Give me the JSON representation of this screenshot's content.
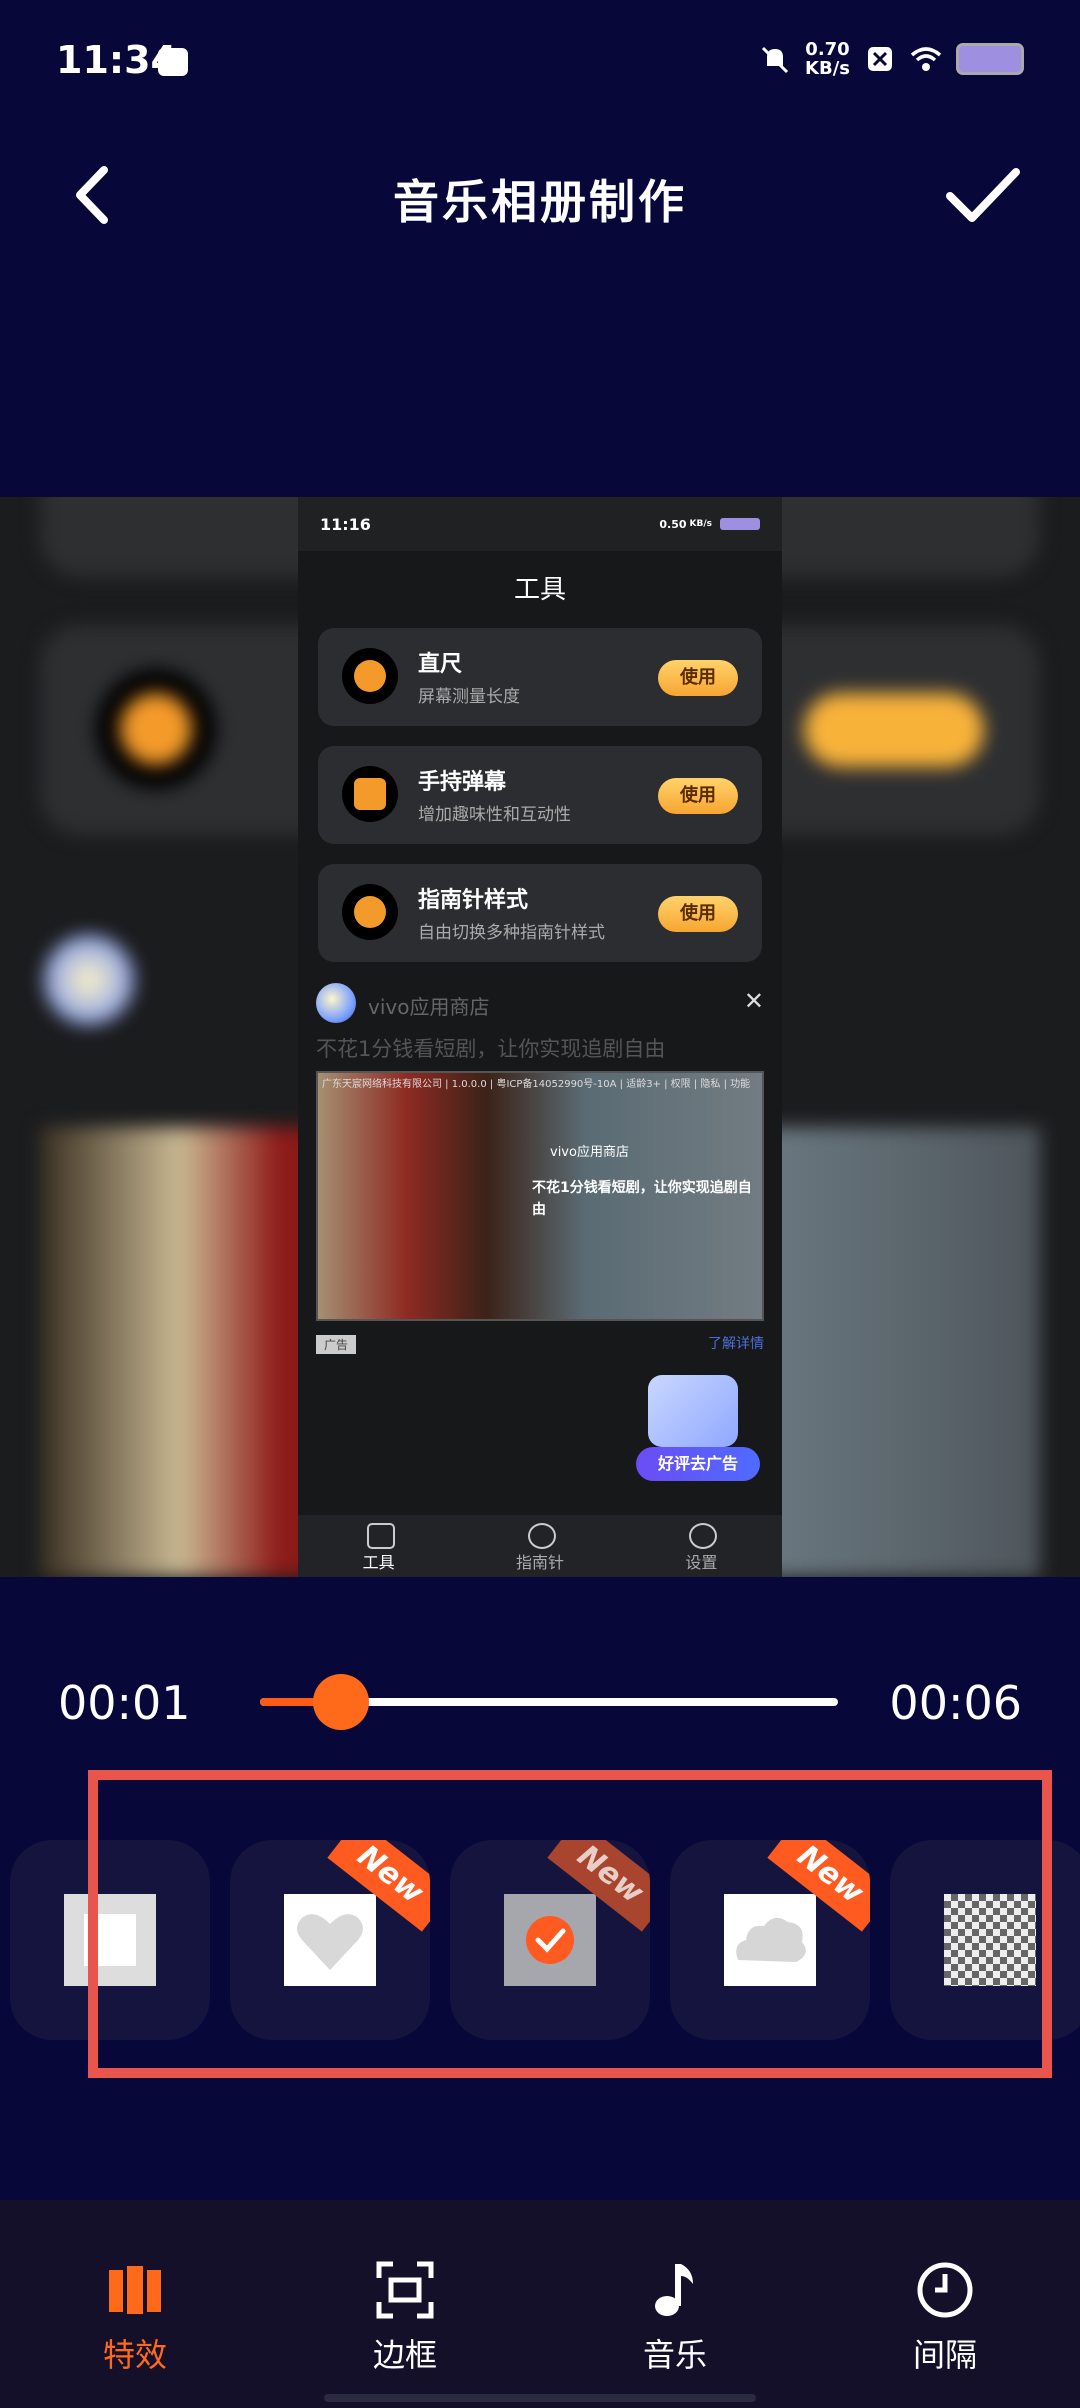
{
  "status_bar": {
    "time": "11:34",
    "speed_value": "0.70",
    "speed_unit": "KB/s"
  },
  "header": {
    "title": "音乐相册制作"
  },
  "preview": {
    "status_time": "11:16",
    "status_speed": "0.50",
    "status_speed_unit": "KB/s",
    "page_title": "工具",
    "tools": [
      {
        "name": "直尺",
        "desc": "屏幕测量长度",
        "action": "使用",
        "icon": "ruler-icon"
      },
      {
        "name": "手持弹幕",
        "desc": "增加趣味性和互动性",
        "action": "使用",
        "icon": "danmaku-icon"
      },
      {
        "name": "指南针样式",
        "desc": "自由切换多种指南针样式",
        "action": "使用",
        "icon": "compass-icon"
      }
    ],
    "ad": {
      "app_name": "vivo应用商店",
      "tagline": "不花1分钱看短剧，让你实现追剧自由",
      "small_print": "广东天宸网络科技有限公司 | 1.0.0.0 | 粤ICP备14052990号-10A | 适龄3+ | 权限 | 隐私 | 功能",
      "inner_name": "vivo应用商店",
      "inner_text": "不花1分钱看短剧，让你实现追剧自由",
      "label": "广告",
      "learn_more": "了解详情",
      "rate_button": "好评去广告"
    },
    "tabs": [
      {
        "label": "工具",
        "active": true
      },
      {
        "label": "指南针",
        "active": false
      },
      {
        "label": "设置",
        "active": false
      }
    ]
  },
  "timeline": {
    "current": "00:01",
    "total": "00:06",
    "progress": 0.14
  },
  "effects": [
    {
      "name": "square-transition",
      "is_new": false,
      "selected": false
    },
    {
      "name": "heart-transition",
      "is_new": true,
      "selected": false
    },
    {
      "name": "selected-transition",
      "is_new": true,
      "selected": true
    },
    {
      "name": "cloud-transition",
      "is_new": true,
      "selected": false
    },
    {
      "name": "mosaic-transition",
      "is_new": false,
      "selected": false
    }
  ],
  "new_badge_text": "New",
  "bottom_nav": [
    {
      "label": "特效",
      "icon": "effects-icon",
      "active": true
    },
    {
      "label": "边框",
      "icon": "frame-icon",
      "active": false
    },
    {
      "label": "音乐",
      "icon": "music-icon",
      "active": false
    },
    {
      "label": "间隔",
      "icon": "clock-icon",
      "active": false
    }
  ],
  "colors": {
    "background": "#07073a",
    "accent": "#ff6a1a",
    "highlight": "#e9544c"
  }
}
